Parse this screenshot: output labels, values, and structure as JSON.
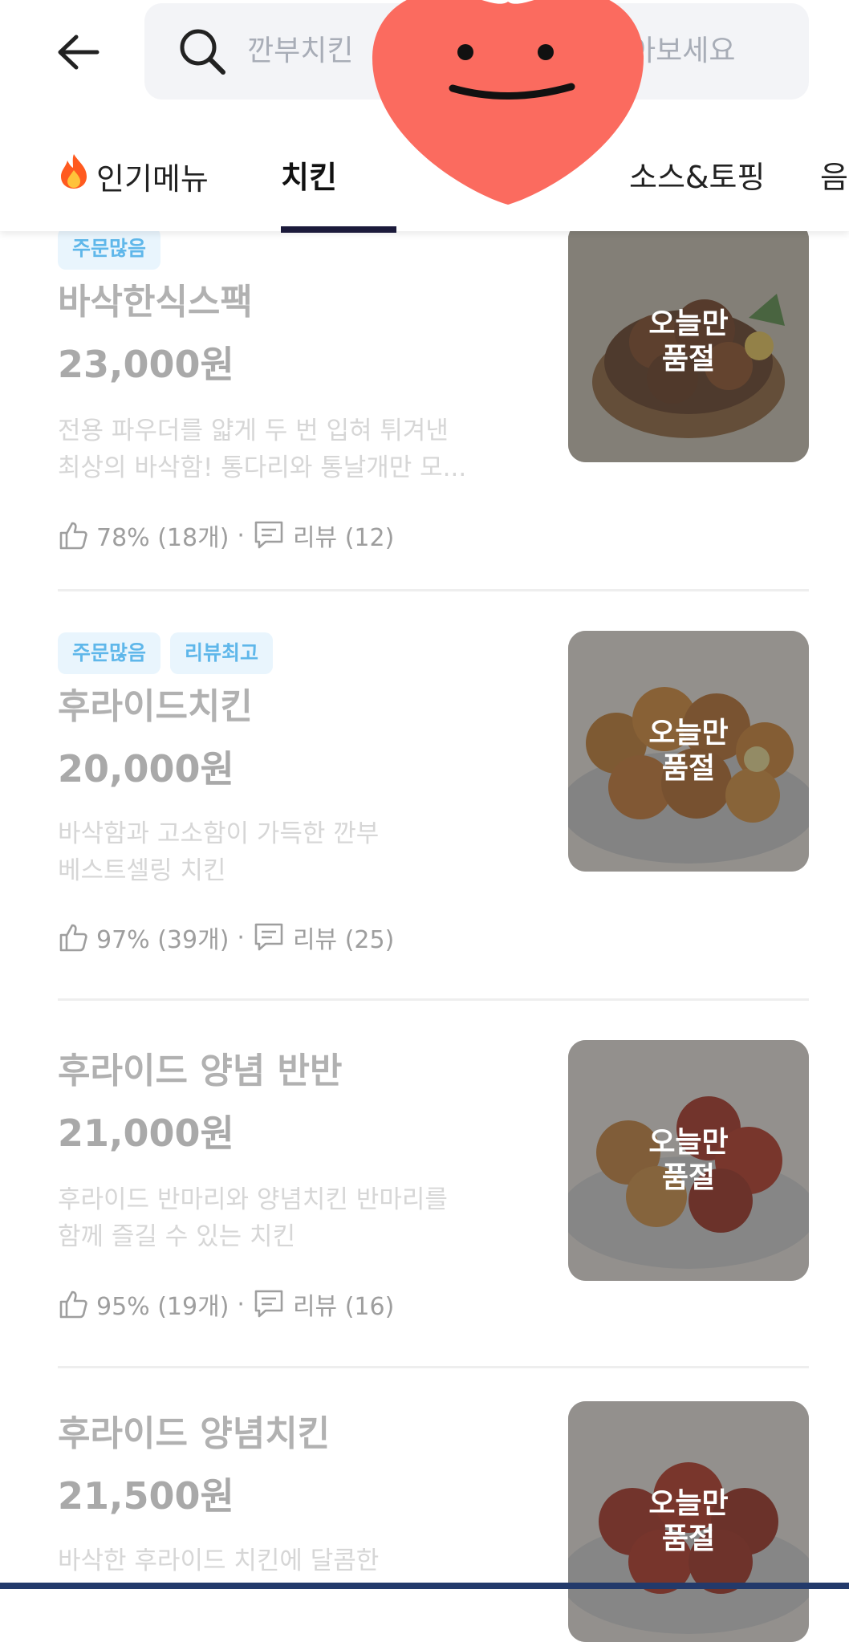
{
  "search": {
    "placeholder_left": "깐부치킨",
    "placeholder_right": "아보세요"
  },
  "tabs": [
    {
      "label": "인기메뉴",
      "icon": "flame-icon"
    },
    {
      "label": "치킨"
    },
    {
      "label": "소스&토핑"
    },
    {
      "label": "음"
    }
  ],
  "active_tab": "치킨",
  "items": [
    {
      "badges": [
        "주문많음"
      ],
      "name": "바삭한식스팩",
      "price": "23,000원",
      "desc": [
        "전용 파우더를 얇게 두 번 입혀 튀겨낸",
        "최상의 바삭함! 통다리와 통날개만 모..."
      ],
      "like": "78% (18개)",
      "review": "리뷰 (12)",
      "soldout": "오늘만\n품절"
    },
    {
      "badges": [
        "주문많음",
        "리뷰최고"
      ],
      "name": "후라이드치킨",
      "price": "20,000원",
      "desc": [
        "바삭함과 고소함이 가득한 깐부",
        "베스트셀링 치킨"
      ],
      "like": "97% (39개)",
      "review": "리뷰 (25)",
      "soldout": "오늘만\n품절"
    },
    {
      "badges": [],
      "name": "후라이드 양념 반반",
      "price": "21,000원",
      "desc": [
        "후라이드 반마리와 양념치킨 반마리를",
        "함께 즐길 수 있는 치킨"
      ],
      "like": "95% (19개)",
      "review": "리뷰 (16)",
      "soldout": "오늘만\n품절"
    },
    {
      "badges": [],
      "name": "후라이드 양념치킨",
      "price": "21,500원",
      "desc": [
        "바삭한 후라이드 치킨에 달콤한"
      ],
      "like": "",
      "review": "",
      "soldout": "오늘만\n품절"
    }
  ],
  "colors": {
    "badge_bg": "#e9f5fd",
    "badge_text": "#5fb7ea",
    "tab_underline": "#1b1a3a",
    "sticker": "#fb6b5f"
  }
}
